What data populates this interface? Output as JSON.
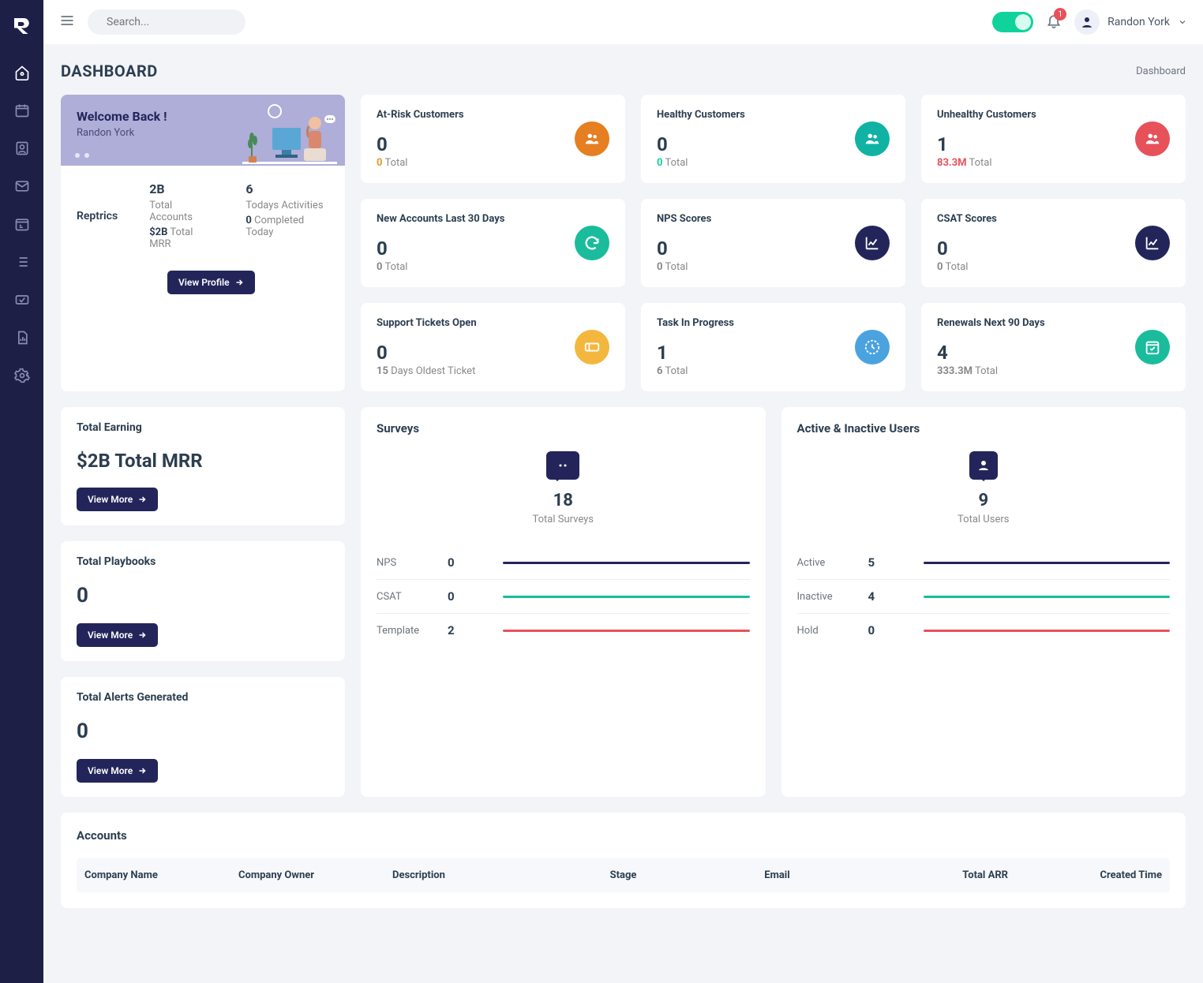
{
  "header": {
    "search_placeholder": "Search...",
    "notification_count": "1",
    "user_name": "Randon York"
  },
  "page": {
    "title": "DASHBOARD",
    "breadcrumb": "Dashboard"
  },
  "welcome": {
    "greeting": "Welcome Back !",
    "name": "Randon York",
    "section_label": "Reptrics",
    "accounts_value": "2B",
    "accounts_label": "Total Accounts",
    "accounts_sub_value": "$2B",
    "accounts_sub_label": " Total MRR",
    "activities_value": "6",
    "activities_label": "Todays Activities",
    "activities_sub_value": "0",
    "activities_sub_label": " Completed Today",
    "profile_btn": "View Profile"
  },
  "stat_cards": [
    {
      "title": "At-Risk Customers",
      "num": "0",
      "subv": "0",
      "subl": " Total",
      "color": "orange",
      "subclass": "sub-orange",
      "icon": "users"
    },
    {
      "title": "Healthy Customers",
      "num": "0",
      "subv": "0",
      "subl": " Total",
      "color": "teal",
      "subclass": "sub-green",
      "icon": "users"
    },
    {
      "title": "Unhealthy Customers",
      "num": "1",
      "subv": "83.3M",
      "subl": " Total",
      "color": "red",
      "subclass": "sub-red",
      "icon": "users"
    },
    {
      "title": "New Accounts Last 30 Days",
      "num": "0",
      "subv": "0",
      "subl": " Total",
      "color": "green",
      "subclass": "",
      "icon": "refresh"
    },
    {
      "title": "NPS Scores",
      "num": "0",
      "subv": "0",
      "subl": " Total",
      "color": "navy",
      "subclass": "",
      "icon": "chart"
    },
    {
      "title": "CSAT Scores",
      "num": "0",
      "subv": "0",
      "subl": " Total",
      "color": "navy",
      "subclass": "",
      "icon": "chart"
    },
    {
      "title": "Support Tickets Open",
      "num": "0",
      "subv": "15",
      "subl": " Days Oldest Ticket",
      "color": "yellow",
      "subclass": "",
      "icon": "ticket"
    },
    {
      "title": "Task In Progress",
      "num": "1",
      "subv": "6",
      "subl": " Total",
      "color": "blue",
      "subclass": "",
      "icon": "clock"
    },
    {
      "title": "Renewals Next 90 Days",
      "num": "4",
      "subv": "333.3M",
      "subl": " Total",
      "color": "green",
      "subclass": "",
      "icon": "calendar"
    }
  ],
  "earning": {
    "title": "Total Earning",
    "amount": "$2B Total MRR",
    "btn": "View More"
  },
  "playbooks": {
    "title": "Total Playbooks",
    "amount": "0",
    "btn": "View More"
  },
  "alerts": {
    "title": "Total Alerts Generated",
    "amount": "0",
    "btn": "View More"
  },
  "surveys": {
    "title": "Surveys",
    "total": "18",
    "total_label": "Total Surveys",
    "rows": [
      {
        "label": "NPS",
        "value": "0",
        "bar": "bar-navy"
      },
      {
        "label": "CSAT",
        "value": "0",
        "bar": "bar-green"
      },
      {
        "label": "Template",
        "value": "2",
        "bar": "bar-red"
      }
    ]
  },
  "users": {
    "title": "Active & Inactive Users",
    "total": "9",
    "total_label": "Total Users",
    "rows": [
      {
        "label": "Active",
        "value": "5",
        "bar": "bar-navy"
      },
      {
        "label": "Inactive",
        "value": "4",
        "bar": "bar-green"
      },
      {
        "label": "Hold",
        "value": "0",
        "bar": "bar-red"
      }
    ]
  },
  "accounts": {
    "title": "Accounts",
    "headers": [
      "Company Name",
      "Company Owner",
      "Description",
      "Stage",
      "Email",
      "Total ARR",
      "Created Time"
    ]
  }
}
